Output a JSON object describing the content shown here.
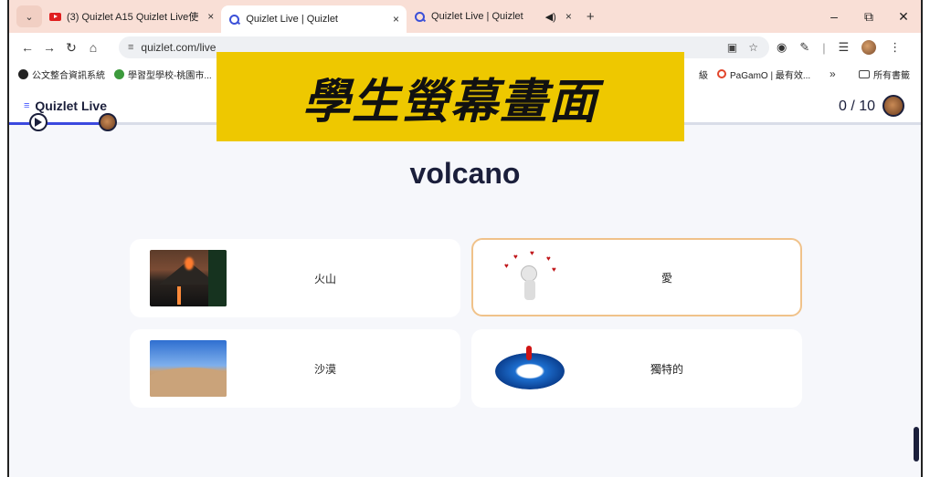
{
  "browser": {
    "tabs": [
      {
        "title": "(3) Quizlet A15 Quizlet Live使",
        "icon": "youtube-icon",
        "active": false
      },
      {
        "title": "Quizlet Live | Quizlet",
        "icon": "quizlet-icon",
        "active": true
      },
      {
        "title": "Quizlet Live | Quizlet",
        "icon": "quizlet-icon",
        "active": false
      }
    ],
    "tab_menu_glyph": "⌄",
    "new_tab_glyph": "+",
    "close_glyph": "×",
    "audio_glyph": "◀)",
    "window_controls": {
      "minimize": "–",
      "restore": "⧉",
      "close": "✕"
    },
    "address": "quizlet.com/live",
    "nav": {
      "back": "←",
      "forward": "→",
      "reload": "↻",
      "home": "⌂"
    },
    "bookmarks": [
      {
        "label": "公文整合資訊系統",
        "color": "#222222"
      },
      {
        "label": "學習型學校-桃園市...",
        "color": "#3c9a3c"
      }
    ],
    "bookmark_partial": "級",
    "bookmark_pagamo": "PaGamO | 最有效...",
    "bookmark_more": "»",
    "bookmark_folder": "所有書籤"
  },
  "quizlet": {
    "logo": "Quizlet Live",
    "logo_mark": "≡",
    "score": "0 / 10",
    "progress_fraction": 0.11
  },
  "overlay": {
    "banner_text": "學生螢幕畫面",
    "banner_color": "#eec800"
  },
  "question": {
    "term": "volcano",
    "options": [
      {
        "label": "火山",
        "image": "volcano-image",
        "selected": false
      },
      {
        "label": "愛",
        "image": "love-figure-image",
        "selected": true
      },
      {
        "label": "沙漠",
        "image": "desert-image",
        "selected": false
      },
      {
        "label": "獨特的",
        "image": "unique-crowd-image",
        "selected": false
      }
    ]
  },
  "colors": {
    "accent": "#3b49df",
    "selected_border": "#f0c28a",
    "tab_strip": "#f9dfd6"
  }
}
